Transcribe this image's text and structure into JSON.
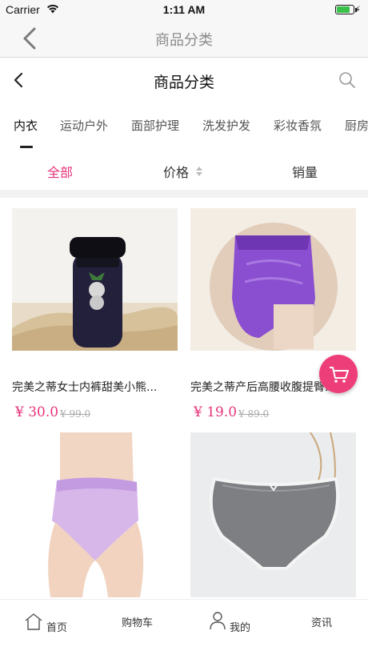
{
  "status_bar": {
    "carrier": "Carrier",
    "time": "1:11 AM",
    "battery_level": 0.8
  },
  "outer_nav": {
    "title": "商品分类"
  },
  "inner_nav": {
    "title": "商品分类"
  },
  "categories": {
    "active_index": 0,
    "items": [
      "内衣",
      "运动户外",
      "面部护理",
      "洗发护发",
      "彩妆香氛",
      "厨房"
    ]
  },
  "sort_bar": {
    "all": "全部",
    "price": "价格",
    "sales": "销量",
    "active": "全部"
  },
  "products": [
    {
      "name": "完美之蒂女士内裤甜美小熊...",
      "price": "¥ 30.0",
      "old_price": "¥ 99.0"
    },
    {
      "name": "完美之蒂产后高腰收腹提臀...",
      "price": "¥ 19.0",
      "old_price": "¥ 89.0"
    },
    {
      "name": "",
      "price": "",
      "old_price": ""
    },
    {
      "name": "",
      "price": "",
      "old_price": ""
    }
  ],
  "tabbar": {
    "home": "首页",
    "cart": "购物车",
    "mine": "我的",
    "news": "资讯"
  },
  "colors": {
    "accent": "#e6337a",
    "fab": "#ee3e7a",
    "battery": "#39c24a"
  }
}
